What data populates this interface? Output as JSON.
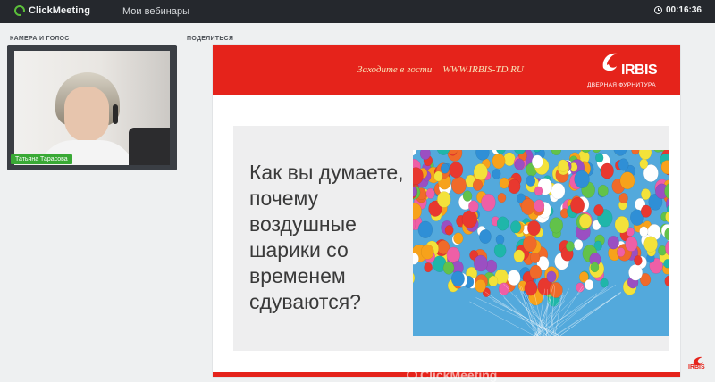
{
  "app": {
    "logo_text": "ClickMeeting",
    "title": "Мои вебинары",
    "timer": "00:16:36"
  },
  "camera": {
    "label": "КАМЕРА И ГОЛОС",
    "presenter_name": "Татьяна Тарасова"
  },
  "share": {
    "label": "ПОДЕЛИТЬСЯ",
    "slide": {
      "header_invite": "Заходите в гости",
      "header_url": "WWW.IRBIS-TD.RU",
      "brand_name": "IRBIS",
      "brand_subtitle": "ДВЕРНАЯ ФУРНИТУРА",
      "question": "Как вы думаете, почему воздушные шарики со временем сдуваются?"
    },
    "watermark": "ClickMeeting",
    "corner_brand": "IRBIS"
  },
  "colors": {
    "topbar": "#25282d",
    "accent_green": "#39a935",
    "slide_red": "#e5231b",
    "sky_blue": "#53a9dc"
  }
}
